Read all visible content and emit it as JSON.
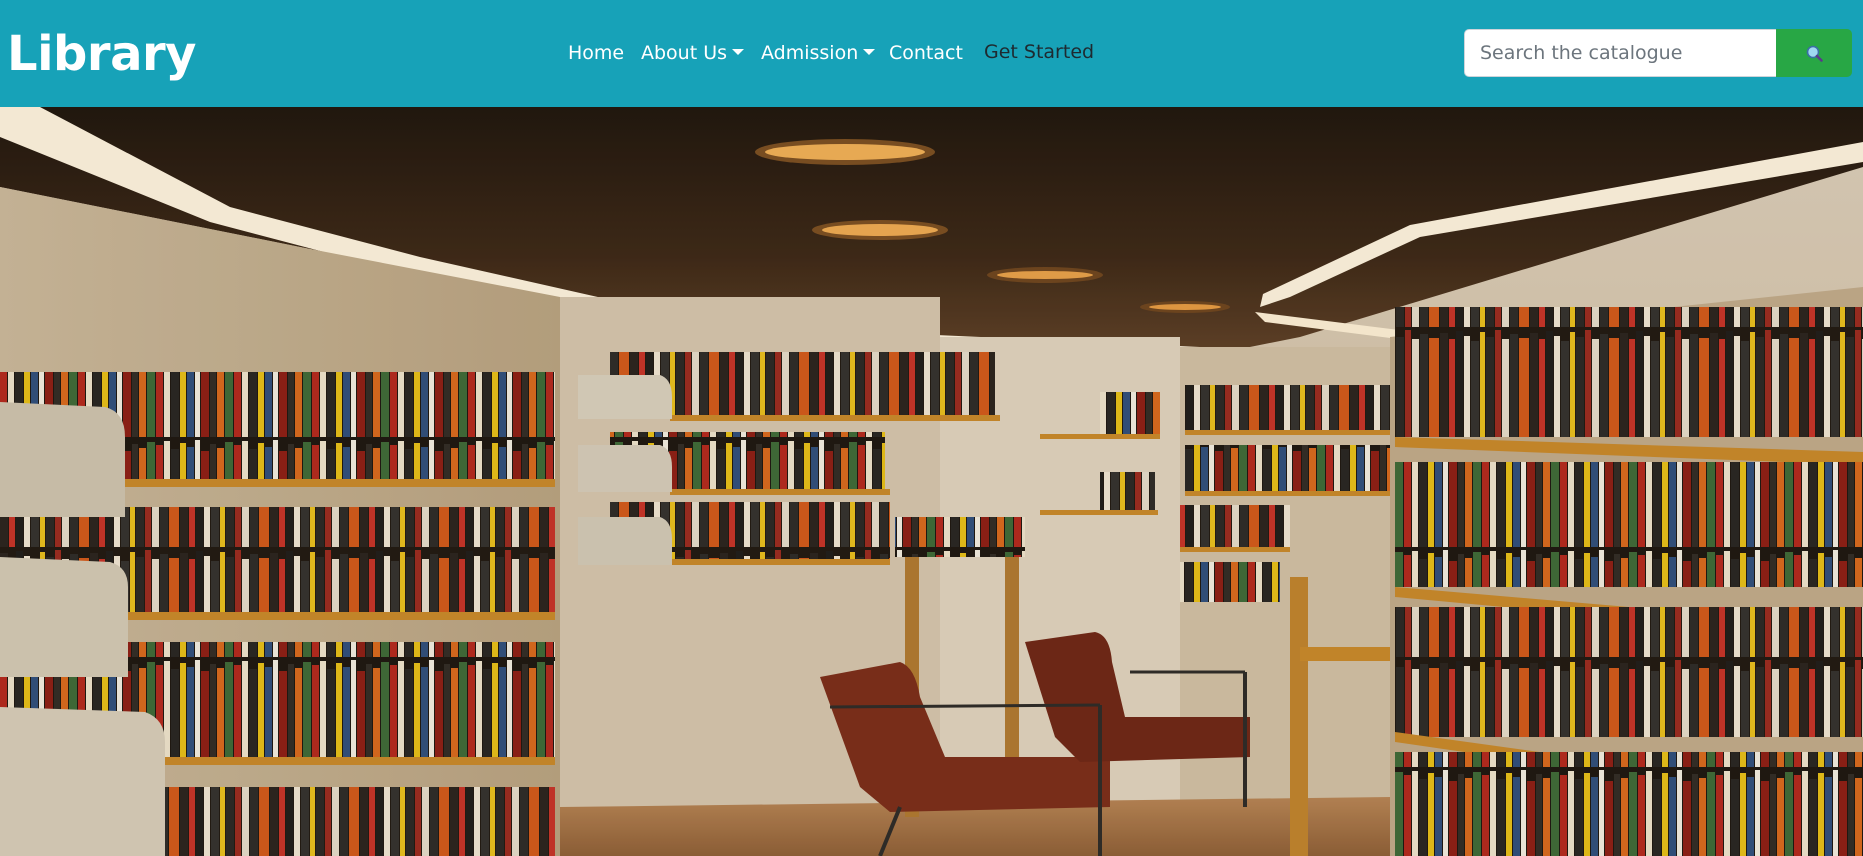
{
  "brand": {
    "name": "Library"
  },
  "nav": {
    "items": [
      {
        "label": "Home",
        "dropdown": false
      },
      {
        "label": "About Us",
        "dropdown": true
      },
      {
        "label": "Admission",
        "dropdown": true
      },
      {
        "label": "Contact",
        "dropdown": false
      }
    ],
    "cta_label": "Get Started"
  },
  "search": {
    "placeholder": "Search the catalogue",
    "value": "",
    "icon": "search-icon"
  },
  "colors": {
    "navbar": "#17a2b8",
    "search_button": "#28a745",
    "text_light": "#ffffff",
    "cta_text": "#1e2a30"
  },
  "hero": {
    "image": "library-interior-photo"
  }
}
